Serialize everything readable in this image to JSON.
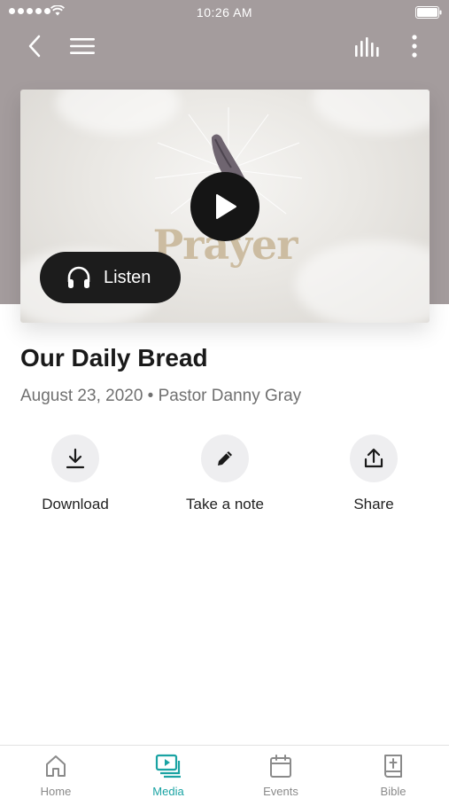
{
  "status_bar": {
    "time": "10:26 AM"
  },
  "media": {
    "artwork_text": "Prayer",
    "listen_label": "Listen"
  },
  "sermon": {
    "title": "Our Daily Bread",
    "meta": "August 23, 2020 • Pastor Danny Gray"
  },
  "actions": [
    {
      "label": "Download",
      "icon": "download-icon"
    },
    {
      "label": "Take a note",
      "icon": "pencil-icon"
    },
    {
      "label": "Share",
      "icon": "share-icon"
    }
  ],
  "tabs": [
    {
      "label": "Home",
      "icon": "home-icon",
      "active": false
    },
    {
      "label": "Media",
      "icon": "media-icon",
      "active": true
    },
    {
      "label": "Events",
      "icon": "calendar-icon",
      "active": false
    },
    {
      "label": "Bible",
      "icon": "bible-icon",
      "active": false
    }
  ],
  "colors": {
    "header_background": "#a49c9d",
    "accent": "#1aa3a3",
    "button_dark": "#1c1c1c"
  }
}
